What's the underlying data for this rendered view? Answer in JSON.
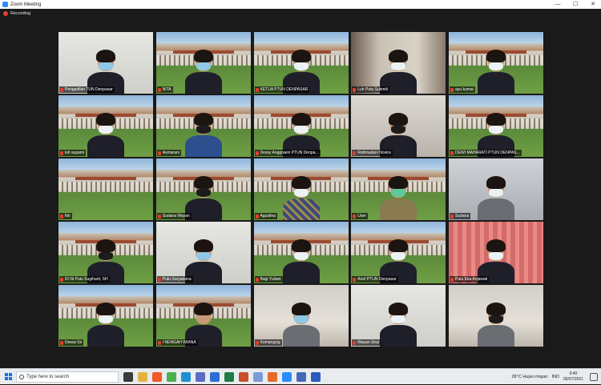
{
  "window": {
    "title": "Zoom Meeting",
    "controls": [
      "—",
      "☐",
      "✕"
    ]
  },
  "recording": {
    "label": "Recording"
  },
  "participants": [
    {
      "name": "Pengadilan TUN Denpasar",
      "bg": "wall",
      "mask": "blue",
      "body": "dark"
    },
    {
      "name": "NITA",
      "bg": "campus",
      "mask": "blue",
      "body": "dark"
    },
    {
      "name": "KETUA PTUN DENPASAR",
      "bg": "campus",
      "mask": "white",
      "body": "dark",
      "active": true
    },
    {
      "name": "Luh Putu Sukmiti",
      "bg": "office",
      "mask": "white",
      "body": "dark"
    },
    {
      "name": "ayu kumai",
      "bg": "campus",
      "mask": "white",
      "body": "dark"
    },
    {
      "name": "luh supami",
      "bg": "campus",
      "mask": "white",
      "body": "dark"
    },
    {
      "name": "Asmarani",
      "bg": "campus",
      "mask": "black",
      "body": "blue"
    },
    {
      "name": "Dessy Anggraeni PTUN Denpa...",
      "bg": "campus",
      "mask": "white",
      "body": "dark"
    },
    {
      "name": "Rahmadani Novira",
      "bg": "indoor",
      "mask": "black",
      "body": "dark"
    },
    {
      "name": "DEWI MAHARATI PTUN DENPAS...",
      "bg": "campus",
      "mask": "white",
      "body": "dark"
    },
    {
      "name": "fitri",
      "bg": "campus",
      "mask": "none",
      "body": "none"
    },
    {
      "name": "Sudana Wayan",
      "bg": "campus",
      "mask": "black",
      "body": "dark"
    },
    {
      "name": "Agustina",
      "bg": "campus",
      "mask": "white",
      "body": "batik"
    },
    {
      "name": "User",
      "bg": "campus",
      "mask": "green",
      "body": "khaki"
    },
    {
      "name": "Sudana",
      "bg": "grey",
      "mask": "white",
      "body": "grey"
    },
    {
      "name": "ID Ni Putu Sugiharti, SH",
      "bg": "campus",
      "mask": "black",
      "body": "dark"
    },
    {
      "name": "Putu Suryadana",
      "bg": "wall",
      "mask": "blue",
      "body": "dark"
    },
    {
      "name": "Bagi Yuliani",
      "bg": "campus",
      "mask": "white",
      "body": "dark"
    },
    {
      "name": "Arief PTUN Denpasar",
      "bg": "campus",
      "mask": "white",
      "body": "dark"
    },
    {
      "name": "Putu Eka Anjawati",
      "bg": "curtain",
      "mask": "white",
      "body": "dark"
    },
    {
      "name": "Dewai Sri",
      "bg": "campus",
      "mask": "white",
      "body": "dark"
    },
    {
      "name": "I NENGAH WIANA",
      "bg": "campus",
      "mask": "none",
      "body": "dark"
    },
    {
      "name": "Komangsig",
      "bg": "room",
      "mask": "blue",
      "body": "grey"
    },
    {
      "name": "Wayan Sirai",
      "bg": "wall",
      "mask": "white",
      "body": "dark"
    },
    {
      "name": "",
      "bg": "room",
      "mask": "black",
      "body": "grey"
    }
  ],
  "taskbar": {
    "search_placeholder": "Type here to search",
    "weather": "28°C  Hujan ringan",
    "language": "IND",
    "time": "9:40",
    "date": "05/07/2021",
    "app_icons": [
      {
        "name": "task-view",
        "color": "#3a3a3a"
      },
      {
        "name": "file-explorer",
        "color": "#e3b341"
      },
      {
        "name": "brave",
        "color": "#f05a28"
      },
      {
        "name": "chrome",
        "color": "#4caf50"
      },
      {
        "name": "edge",
        "color": "#1f8fd1"
      },
      {
        "name": "store",
        "color": "#5b6cc1"
      },
      {
        "name": "mail",
        "color": "#2b6fd6"
      },
      {
        "name": "excel",
        "color": "#1f7a45"
      },
      {
        "name": "powerpoint",
        "color": "#c9502b"
      },
      {
        "name": "paint",
        "color": "#7a9bd8"
      },
      {
        "name": "firefox",
        "color": "#e56a2b"
      },
      {
        "name": "zoom",
        "color": "#2d8cff"
      },
      {
        "name": "media",
        "color": "#4468b8"
      },
      {
        "name": "word",
        "color": "#2b5bbd"
      }
    ]
  }
}
